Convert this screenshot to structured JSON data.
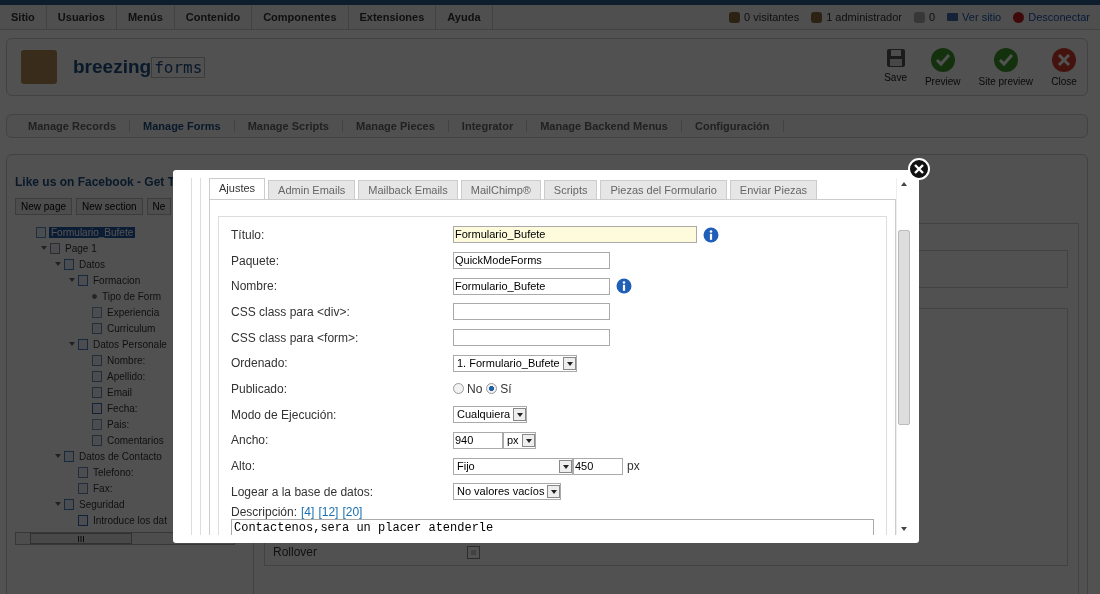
{
  "top_menu": [
    {
      "label": "Sitio"
    },
    {
      "label": "Usuarios"
    },
    {
      "label": "Menús"
    },
    {
      "label": "Contenido"
    },
    {
      "label": "Componentes"
    },
    {
      "label": "Extensiones"
    },
    {
      "label": "Ayuda"
    }
  ],
  "status": [
    {
      "kind": "visitors",
      "label": "0 visitantes"
    },
    {
      "kind": "admins",
      "label": "1 administrador"
    },
    {
      "kind": "messages",
      "label": "0"
    },
    {
      "kind": "site",
      "label": "Ver sitio"
    },
    {
      "kind": "logout",
      "label": "Desconectar"
    }
  ],
  "logo": {
    "part_1": "breezing",
    "part_2": "forms"
  },
  "toolbar": [
    {
      "kind": "save",
      "label": "Save"
    },
    {
      "kind": "ok",
      "label": "Preview"
    },
    {
      "kind": "ok",
      "label": "Site preview"
    },
    {
      "kind": "close",
      "label": "Close"
    }
  ],
  "submenu": [
    {
      "label": "Manage Records",
      "selected": false
    },
    {
      "label": "Manage Forms",
      "selected": true
    },
    {
      "label": "Manage Scripts",
      "selected": false
    },
    {
      "label": "Manage Pieces",
      "selected": false
    },
    {
      "label": "Integrator",
      "selected": false
    },
    {
      "label": "Manage Backend Menus",
      "selected": false
    },
    {
      "label": "Configuración",
      "selected": false
    }
  ],
  "panel_title": "Like us on Facebook - Get T",
  "panel_buttons": [
    "New page",
    "New section",
    "Ne"
  ],
  "tree": [
    {
      "label": "Formulario_Bufete",
      "kind": "form",
      "selected": true,
      "children": [
        {
          "label": "Page 1",
          "kind": "page",
          "selected": false,
          "expanded": true,
          "children": [
            {
              "label": "Datos",
              "kind": "section",
              "selected": false,
              "expanded": true,
              "children": [
                {
                  "label": "Formacion",
                  "kind": "section",
                  "selected": false,
                  "expanded": true,
                  "children": [
                    {
                      "label": "Tipo de Form",
                      "kind": "radio",
                      "selected": false
                    },
                    {
                      "label": "Experiencia",
                      "kind": "select",
                      "selected": false
                    },
                    {
                      "label": "Curriculum",
                      "kind": "file",
                      "selected": false
                    }
                  ]
                },
                {
                  "label": "Datos Personale",
                  "kind": "section",
                  "selected": false,
                  "expanded": true,
                  "children": [
                    {
                      "label": "Nombre:",
                      "kind": "text",
                      "selected": false
                    },
                    {
                      "label": "Apellido:",
                      "kind": "text",
                      "selected": false
                    },
                    {
                      "label": "Email",
                      "kind": "text",
                      "selected": false
                    },
                    {
                      "label": "Fecha:",
                      "kind": "date",
                      "selected": false
                    },
                    {
                      "label": "Pais:",
                      "kind": "select",
                      "selected": false
                    },
                    {
                      "label": "Comentarios",
                      "kind": "file",
                      "selected": false
                    }
                  ]
                }
              ]
            },
            {
              "label": "Datos de Contacto",
              "kind": "section",
              "selected": false,
              "expanded": true,
              "children": [
                {
                  "label": "Telefono:",
                  "kind": "text",
                  "selected": false
                },
                {
                  "label": "Fax:",
                  "kind": "text",
                  "selected": false
                }
              ]
            },
            {
              "label": "Seguridad",
              "kind": "section",
              "selected": false,
              "expanded": true,
              "children": [
                {
                  "label": "Introduce los dat",
                  "kind": "captcha",
                  "selected": false
                }
              ]
            }
          ]
        }
      ]
    }
  ],
  "tree_scroll_label": "III",
  "background_field": {
    "label": "Rollover",
    "checked": true
  },
  "modal": {
    "tabs": [
      {
        "label": "Ajustes",
        "selected": true
      },
      {
        "label": "Admin Emails",
        "selected": false
      },
      {
        "label": "Mailback Emails",
        "selected": false
      },
      {
        "label": "MailChimp®",
        "selected": false
      },
      {
        "label": "Scripts",
        "selected": false
      },
      {
        "label": "Piezas del Formulario",
        "selected": false
      },
      {
        "label": "Enviar Piezas",
        "selected": false
      }
    ],
    "fields": [
      {
        "kind": "text",
        "label": "Título:",
        "value": "Formulario_Bufete",
        "wide": true,
        "info": true
      },
      {
        "kind": "text",
        "label": "Paquete:",
        "value": "QuickModeForms",
        "wide": false,
        "info": false
      },
      {
        "kind": "text",
        "label": "Nombre:",
        "value": "Formulario_Bufete",
        "wide": false,
        "info": true
      },
      {
        "kind": "text",
        "label": "CSS class para <div>:",
        "wide": false,
        "info": false
      },
      {
        "kind": "text",
        "label": "CSS class para <form>:",
        "wide": false,
        "info": false
      },
      {
        "kind": "select",
        "label": "Ordenado:",
        "value": "1. Formulario_Bufete"
      },
      {
        "kind": "radio",
        "label": "Publicado:",
        "options": [
          {
            "label": "No",
            "selected": false
          },
          {
            "label": "Sí",
            "selected": true
          }
        ]
      },
      {
        "kind": "select",
        "label": "Modo de Ejecución:",
        "value": "Cualquiera"
      },
      {
        "kind": "size",
        "label": "Ancho:",
        "value": "940",
        "unit": "px"
      },
      {
        "kind": "height",
        "label": "Alto:",
        "mode": "Fijo",
        "value": "450",
        "unit": "px"
      },
      {
        "kind": "select",
        "label": "Logear a la base de datos:",
        "value": "No valores vacíos"
      },
      {
        "kind": "textarea",
        "label": "Descripción:",
        "links": [
          "[4]",
          "[12]",
          "[20]"
        ],
        "value": "Contactenos,sera un placer atenderle"
      }
    ]
  }
}
